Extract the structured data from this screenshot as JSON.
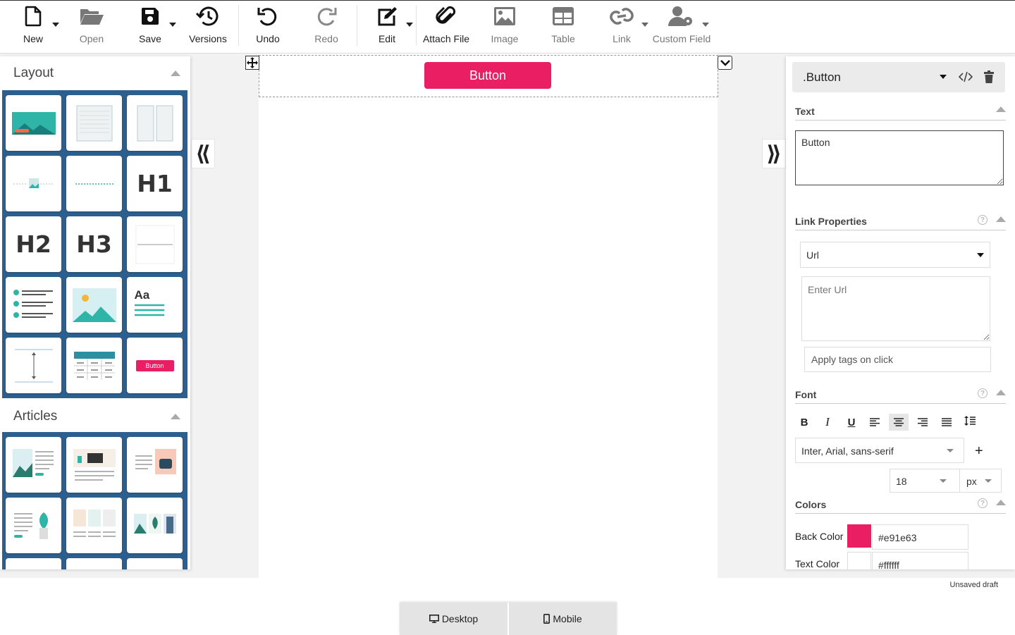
{
  "toolbar": {
    "new": "New",
    "open": "Open",
    "save": "Save",
    "versions": "Versions",
    "undo": "Undo",
    "redo": "Redo",
    "edit": "Edit",
    "attach_file": "Attach File",
    "image": "Image",
    "table": "Table",
    "link": "Link",
    "custom_field": "Custom Field"
  },
  "left_panel": {
    "layout_title": "Layout",
    "articles_title": "Articles",
    "tiles": {
      "h1": "H1",
      "h2": "H2",
      "h3": "H3",
      "aa": "Aa",
      "button_preview": "Button"
    }
  },
  "canvas": {
    "button_label": "Button"
  },
  "right_panel": {
    "selected_element": ".Button",
    "text_section": "Text",
    "text_value": "Button",
    "link_section": "Link Properties",
    "link_type": "Url",
    "url_placeholder": "Enter Url",
    "tags_placeholder": "Apply tags on click",
    "font_section": "Font",
    "font_family": "Inter, Arial, sans-serif",
    "font_size": "18",
    "font_unit": "px",
    "colors_section": "Colors",
    "back_color_label": "Back Color",
    "back_color_value": "#e91e63",
    "text_color_label": "Text Color",
    "text_color_value": "#ffffff",
    "help_glyph": "?",
    "format_bold": "B",
    "format_italic": "I",
    "format_underline": "U"
  },
  "footer": {
    "status": "Unsaved draft",
    "desktop": "Desktop",
    "mobile": "Mobile"
  },
  "colors": {
    "accent": "#e91e63",
    "panel_blue": "#2d5f8e",
    "teal": "#20a39e"
  }
}
